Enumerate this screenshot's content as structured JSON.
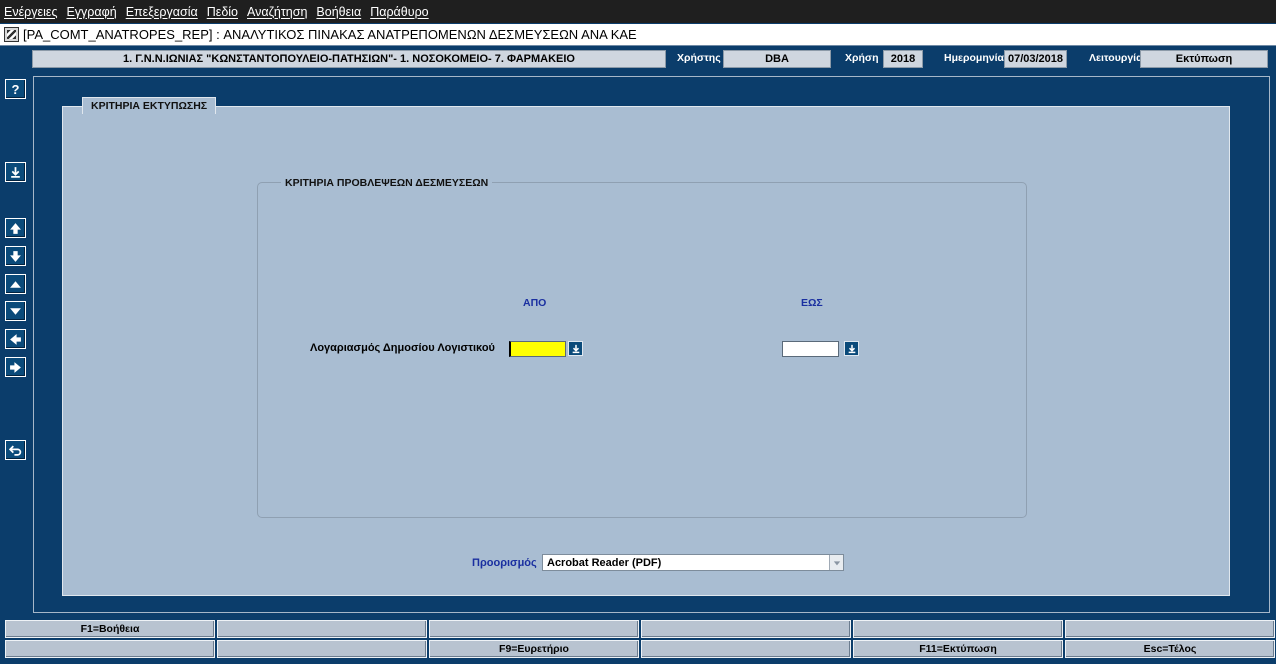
{
  "menu": [
    "Ενέργειες",
    "Εγγραφή",
    "Επεξεργασία",
    "Πεδίο",
    "Αναζήτηση",
    "Βοήθεια",
    "Παράθυρο"
  ],
  "window": {
    "title": "[PA_COMT_ANATROPES_REP]  :  ΑΝΑΛΥΤΙΚΟΣ ΠΙΝΑΚΑΣ ΑΝΑΤΡΕΠΟΜΕΝΩΝ ΔΕΣΜΕΥΣΕΩΝ ΑΝΑ ΚΑΕ"
  },
  "infobar": {
    "org": "1. Γ.Ν.Ν.ΙΩΝΙΑΣ \"ΚΩΝΣΤΑΝΤΟΠΟΥΛΕΙΟ-ΠΑΤΗΣΙΩΝ\"- 1. ΝΟΣΟΚΟΜΕΙΟ- 7. ΦΑΡΜΑΚΕΙΟ",
    "user_label": "Χρήστης",
    "user_value": "DBA",
    "year_label": "Χρήση",
    "year_value": "2018",
    "date_label": "Ημερομηνία",
    "date_value": "07/03/2018",
    "mode_label": "Λειτουργία",
    "mode_value": "Εκτύπωση"
  },
  "toolbar": {
    "help_glyph": "?"
  },
  "panel": {
    "tab_label": "ΚΡΙΤΗΡΙΑ ΕΚΤΥΠΩΣΗΣ",
    "group_title": "ΚΡΙΤΗΡΙΑ  ΠΡΟΒΛΕΨΕΩΝ ΔΕΣΜΕΥΣΕΩΝ",
    "from_header": "ΑΠΟ",
    "to_header": "ΕΩΣ",
    "row_label": "Λογαριασμός Δημοσίου Λογιστικού",
    "from_value": "",
    "to_value": "",
    "destination_label": "Προορισμός",
    "destination_value": "Acrobat Reader (PDF)"
  },
  "fkeys": {
    "row1": [
      "F1=Βοήθεια",
      "",
      "",
      "",
      "",
      ""
    ],
    "row2": [
      "",
      "",
      "F9=Ευρετήριο",
      "",
      "F11=Εκτύπωση",
      "Esc=Τέλος"
    ]
  },
  "colors": {
    "background": "#0b3d6b",
    "panel": "#a9bdd2",
    "active_field": "#ffff00",
    "header_text": "#1a2fa0"
  }
}
